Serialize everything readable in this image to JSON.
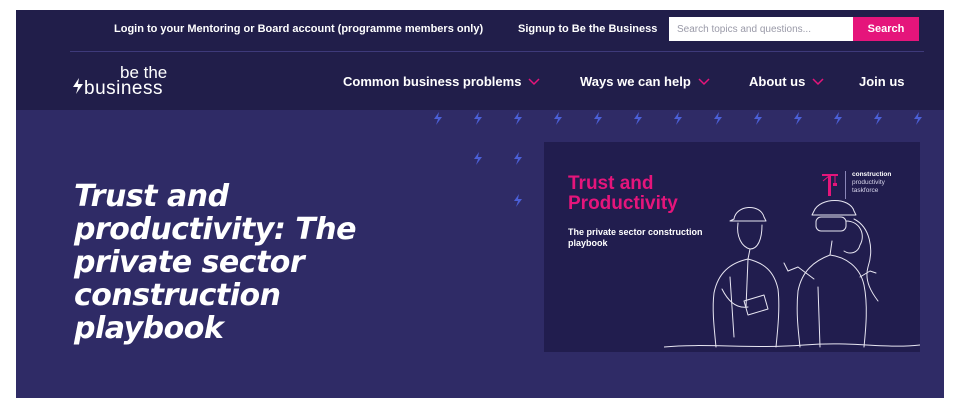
{
  "topbar": {
    "login_link": "Login to your Mentoring or Board account (programme members only)",
    "signup_link": "Signup to Be the Business",
    "search_placeholder": "Search topics and questions...",
    "search_button": "Search"
  },
  "logo": {
    "line1": "be the",
    "line2": "business"
  },
  "nav": {
    "items": [
      {
        "label": "Common business problems",
        "icon": "chevron-down-icon"
      },
      {
        "label": "Ways we can help",
        "icon": "chevron-down-icon"
      },
      {
        "label": "About us",
        "icon": "chevron-down-icon"
      },
      {
        "label": "Join us"
      }
    ]
  },
  "hero": {
    "title": "Trust and productivity: The private sector construction playbook",
    "card": {
      "title_line1": "Trust and",
      "title_line2": "Productivity",
      "subtitle": "The private sector construction playbook",
      "brand_line1": "construction",
      "brand_line2": "productivity",
      "brand_line3": "taskforce"
    }
  },
  "colors": {
    "accent": "#e5157b",
    "nav_bg": "#211e4a",
    "hero_bg": "#2f2b66",
    "bolt": "#4b5fd6"
  }
}
